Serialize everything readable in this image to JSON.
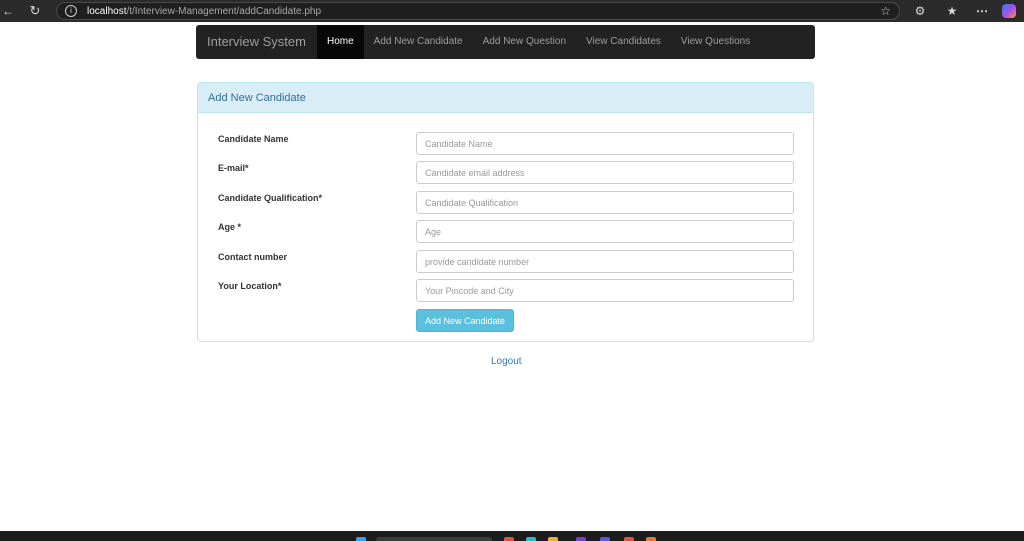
{
  "browser": {
    "url_host": "localhost",
    "url_path": "/t/Interview-Management/addCandidate.php",
    "icons": [
      "back-icon",
      "refresh-icon",
      "info-icon",
      "star-icon",
      "extensions-icon",
      "favorites-icon",
      "more-icon",
      "copilot-icon"
    ]
  },
  "navbar": {
    "brand": "Interview System",
    "items": [
      {
        "label": "Home",
        "active": true
      },
      {
        "label": "Add New Candidate",
        "active": false
      },
      {
        "label": "Add New Question",
        "active": false
      },
      {
        "label": "View Candidates",
        "active": false
      },
      {
        "label": "View Questions",
        "active": false
      }
    ]
  },
  "panel": {
    "heading": "Add New Candidate",
    "fields": [
      {
        "label": "Candidate Name",
        "placeholder": "Candidate Name",
        "value": ""
      },
      {
        "label": "E-mail*",
        "placeholder": "Candidate email address",
        "value": ""
      },
      {
        "label": "Candidate Qualification*",
        "placeholder": "Candidate Qualification",
        "value": ""
      },
      {
        "label": "Age *",
        "placeholder": "Age",
        "value": ""
      },
      {
        "label": "Contact number",
        "placeholder": "provide candidate number",
        "value": ""
      },
      {
        "label": "Your Location*",
        "placeholder": "Your Pincode and City",
        "value": ""
      }
    ],
    "submit_label": "Add New Candidate"
  },
  "logout_label": "Logout",
  "colors": {
    "navbar_bg": "#222222",
    "nav_active_bg": "#080808",
    "panel_heading_bg": "#d9edf7",
    "panel_heading_text": "#31708f",
    "button_bg": "#5bc0de",
    "link": "#337ab7"
  }
}
